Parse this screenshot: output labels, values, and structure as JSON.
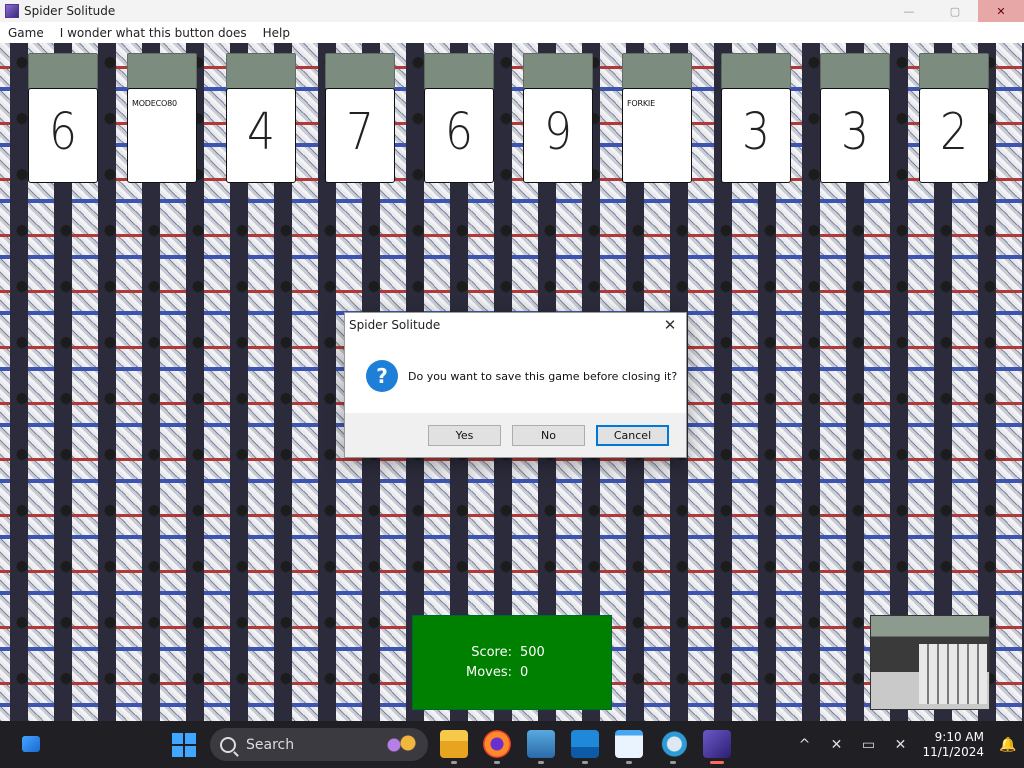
{
  "window": {
    "title": "Spider Solitude",
    "controls": {
      "minimize": "—",
      "maximize": "▢",
      "close": "✕"
    }
  },
  "menu": [
    "Game",
    "I wonder what this button does",
    "Help"
  ],
  "columns": [
    {
      "face": "6"
    },
    {
      "face": "",
      "word": "MODECO80"
    },
    {
      "face": "4"
    },
    {
      "face": "7"
    },
    {
      "face": "6"
    },
    {
      "face": "9"
    },
    {
      "face": "",
      "word": "FORKIE"
    },
    {
      "face": "3"
    },
    {
      "face": "3"
    },
    {
      "face": "2"
    }
  ],
  "dialog": {
    "title": "Spider Solitude",
    "close": "✕",
    "icon": "question-icon",
    "icon_glyph": "?",
    "message": "Do you want to save this game before closing it?",
    "buttons": {
      "yes": "Yes",
      "no": "No",
      "cancel": "Cancel"
    }
  },
  "score": {
    "score_label": "Score:",
    "score_value": "500",
    "moves_label": "Moves:",
    "moves_value": "0"
  },
  "taskbar": {
    "search_placeholder": "Search",
    "clock": {
      "time": "9:10 AM",
      "date": "11/1/2024"
    },
    "tray": {
      "chevron": "^",
      "network": "✕",
      "display": "▭",
      "sound": "✕",
      "bell": "🔔"
    }
  },
  "colors": {
    "score_bg": "#008000",
    "card_back": "#7c8c7e",
    "taskbar_bg": "#1f1f24",
    "dialog_accent": "#0078d7"
  }
}
